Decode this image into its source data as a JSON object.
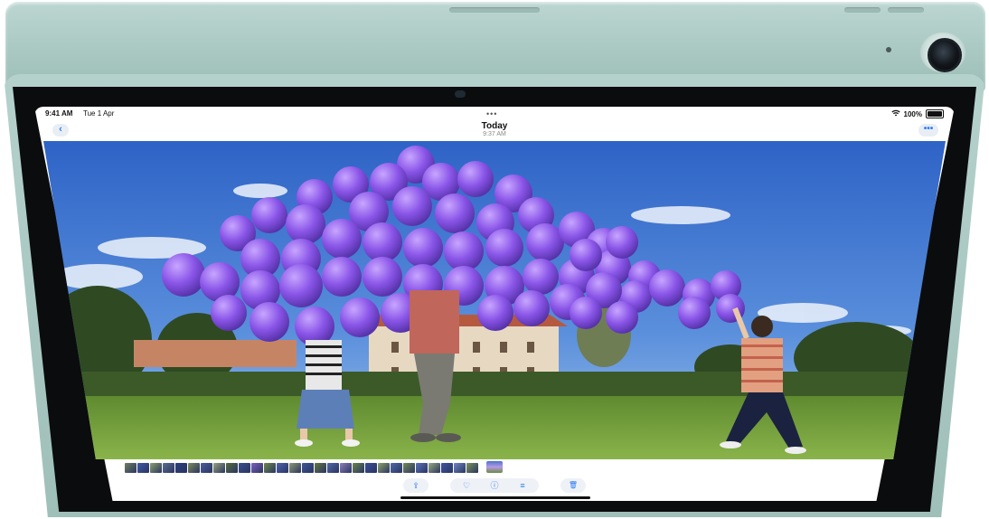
{
  "status_bar": {
    "time": "9:41 AM",
    "date": "Tue 1 Apr",
    "wifi_icon": "wifi-icon",
    "battery": "100%"
  },
  "nav": {
    "back_icon": "‹",
    "title": "Today",
    "subtitle": "9:37 AM",
    "more_icon": "•••",
    "multitask_icon": "•••"
  },
  "photo": {
    "description_icon": "photo-viewer",
    "sky_color": "#3f74cf",
    "balloon_color": "#8a55e8",
    "grass_color": "#6e9a3a"
  },
  "thumbnails": {
    "count": 28,
    "colors": [
      "#6f7f5e",
      "#3e5aa8",
      "#8ca06a",
      "#5d6e8f",
      "#2c3f7a",
      "#7c8d5a",
      "#4a5d9c",
      "#98a37b",
      "#556b3f",
      "#3b4f8d",
      "#7d5fc0",
      "#6d8a4a",
      "#4c64b0",
      "#8e9a72",
      "#3f5698",
      "#64773f",
      "#506aa8",
      "#8a7fb8",
      "#6a844c",
      "#3a4f96",
      "#8da26a",
      "#4e6aa6",
      "#758a55",
      "#5b72b8",
      "#9aa87d",
      "#3e55a0",
      "#6f86c4",
      "#7b9458"
    ]
  },
  "toolbar": {
    "share_icon": "⇪",
    "favorite_icon": "♡",
    "info_icon": "ⓘ",
    "adjust_icon": "≡",
    "delete_icon": "🗑"
  }
}
